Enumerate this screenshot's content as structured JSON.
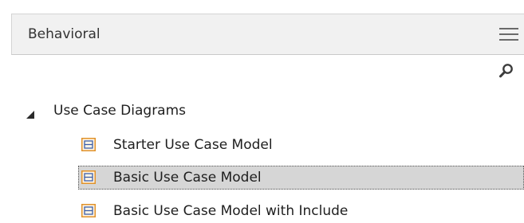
{
  "panel": {
    "title": "Behavioral"
  },
  "icons": {
    "menu": "hamburger-menu-icon",
    "search": "search-icon",
    "expand": "expanded-triangle-icon",
    "diagram": "use-case-diagram-icon"
  },
  "colors": {
    "header_bg": "#f1f1f1",
    "selected_bg": "#d6d6d6",
    "icon_orange": "#e0922a",
    "icon_blue": "#3a5ea8"
  },
  "tree": {
    "folder": {
      "label": "Use Case Diagrams",
      "expanded": true
    },
    "items": [
      {
        "label": "Starter Use Case Model",
        "selected": false
      },
      {
        "label": "Basic Use Case Model",
        "selected": true
      },
      {
        "label": "Basic Use Case Model with Include",
        "selected": false
      }
    ]
  }
}
